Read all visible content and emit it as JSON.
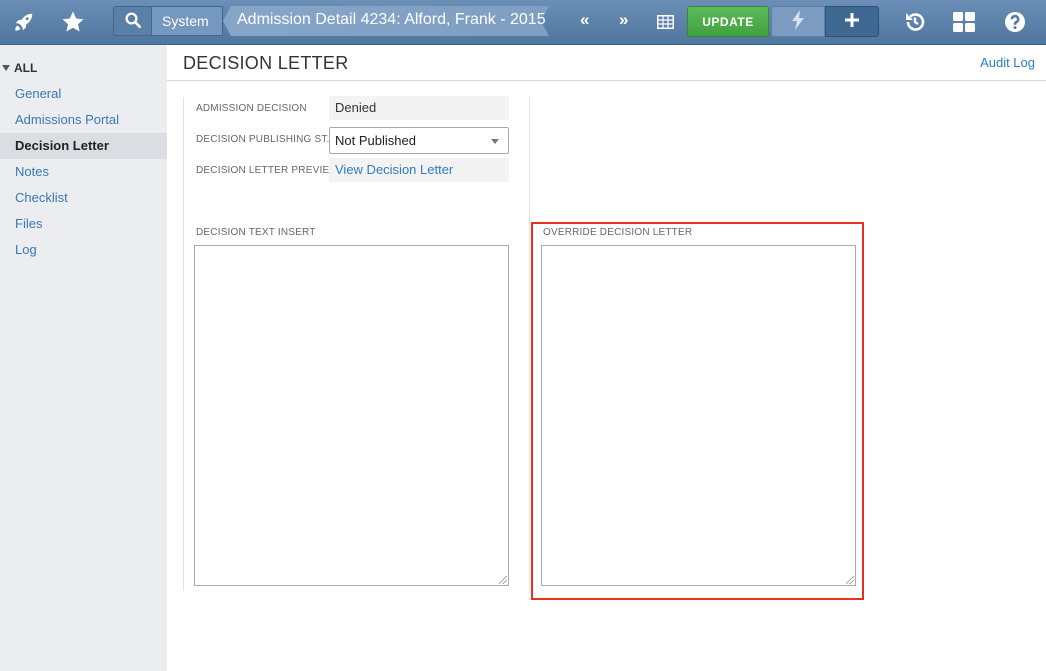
{
  "topbar": {
    "icons": [
      "rocket-icon",
      "star-icon",
      "search-icon",
      "grid-icon",
      "bolt-icon",
      "plus-icon",
      "history-icon",
      "dashboard-icon",
      "help-icon"
    ],
    "system_label": "System",
    "title": "Admission Detail 4234: Alford, Frank - 2015",
    "prev_label": "«",
    "next_label": "»",
    "update_label": "UPDATE",
    "plus_label": "+"
  },
  "sidebar": {
    "root_label": "ALL",
    "items": [
      {
        "label": "General",
        "active": false
      },
      {
        "label": "Admissions Portal",
        "active": false
      },
      {
        "label": "Decision Letter",
        "active": true
      },
      {
        "label": "Notes",
        "active": false
      },
      {
        "label": "Checklist",
        "active": false
      },
      {
        "label": "Files",
        "active": false
      },
      {
        "label": "Log",
        "active": false
      }
    ]
  },
  "main": {
    "page_title": "DECISION LETTER",
    "audit_log_label": "Audit Log",
    "fields": {
      "admission_decision_label": "ADMISSION DECISION",
      "admission_decision_value": "Denied",
      "publishing_status_label": "DECISION PUBLISHING ST...",
      "publishing_status_value": "Not Published",
      "preview_label": "DECISION LETTER PREVIEW",
      "preview_link": "View Decision Letter"
    },
    "decision_text_insert_label": "DECISION TEXT INSERT",
    "decision_text_insert_value": "",
    "override_letter_label": "OVERRIDE DECISION LETTER",
    "override_letter_value": ""
  },
  "colors": {
    "topbar": "#5a7fa8",
    "update_button": "#4cae4a",
    "link": "#2f7bc1",
    "highlight_border": "#e8321d",
    "sidebar_bg": "#ebedf0"
  }
}
